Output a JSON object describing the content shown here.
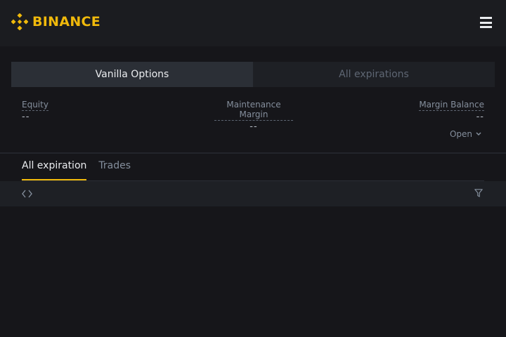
{
  "brand": {
    "name": "BINANCE",
    "color": "#f0b90b"
  },
  "header": {
    "menu_icon": "hamburger-menu-icon"
  },
  "segment": {
    "vanilla_label": "Vanilla Options",
    "expirations_label": "All expirations",
    "active": "vanilla"
  },
  "metrics": {
    "equity": {
      "label": "Equity",
      "value": "--"
    },
    "maintenance_margin": {
      "label": "Maintenance Margin",
      "value": "--"
    },
    "margin_balance": {
      "label": "Margin Balance",
      "value": "--"
    }
  },
  "open_dropdown": {
    "label": "Open"
  },
  "tabs": [
    {
      "label": "All expiration",
      "active": true
    },
    {
      "label": "Trades",
      "active": false
    }
  ],
  "toolbar": {
    "left_icon": "code-brackets-icon",
    "right_icon": "filter-icon"
  }
}
